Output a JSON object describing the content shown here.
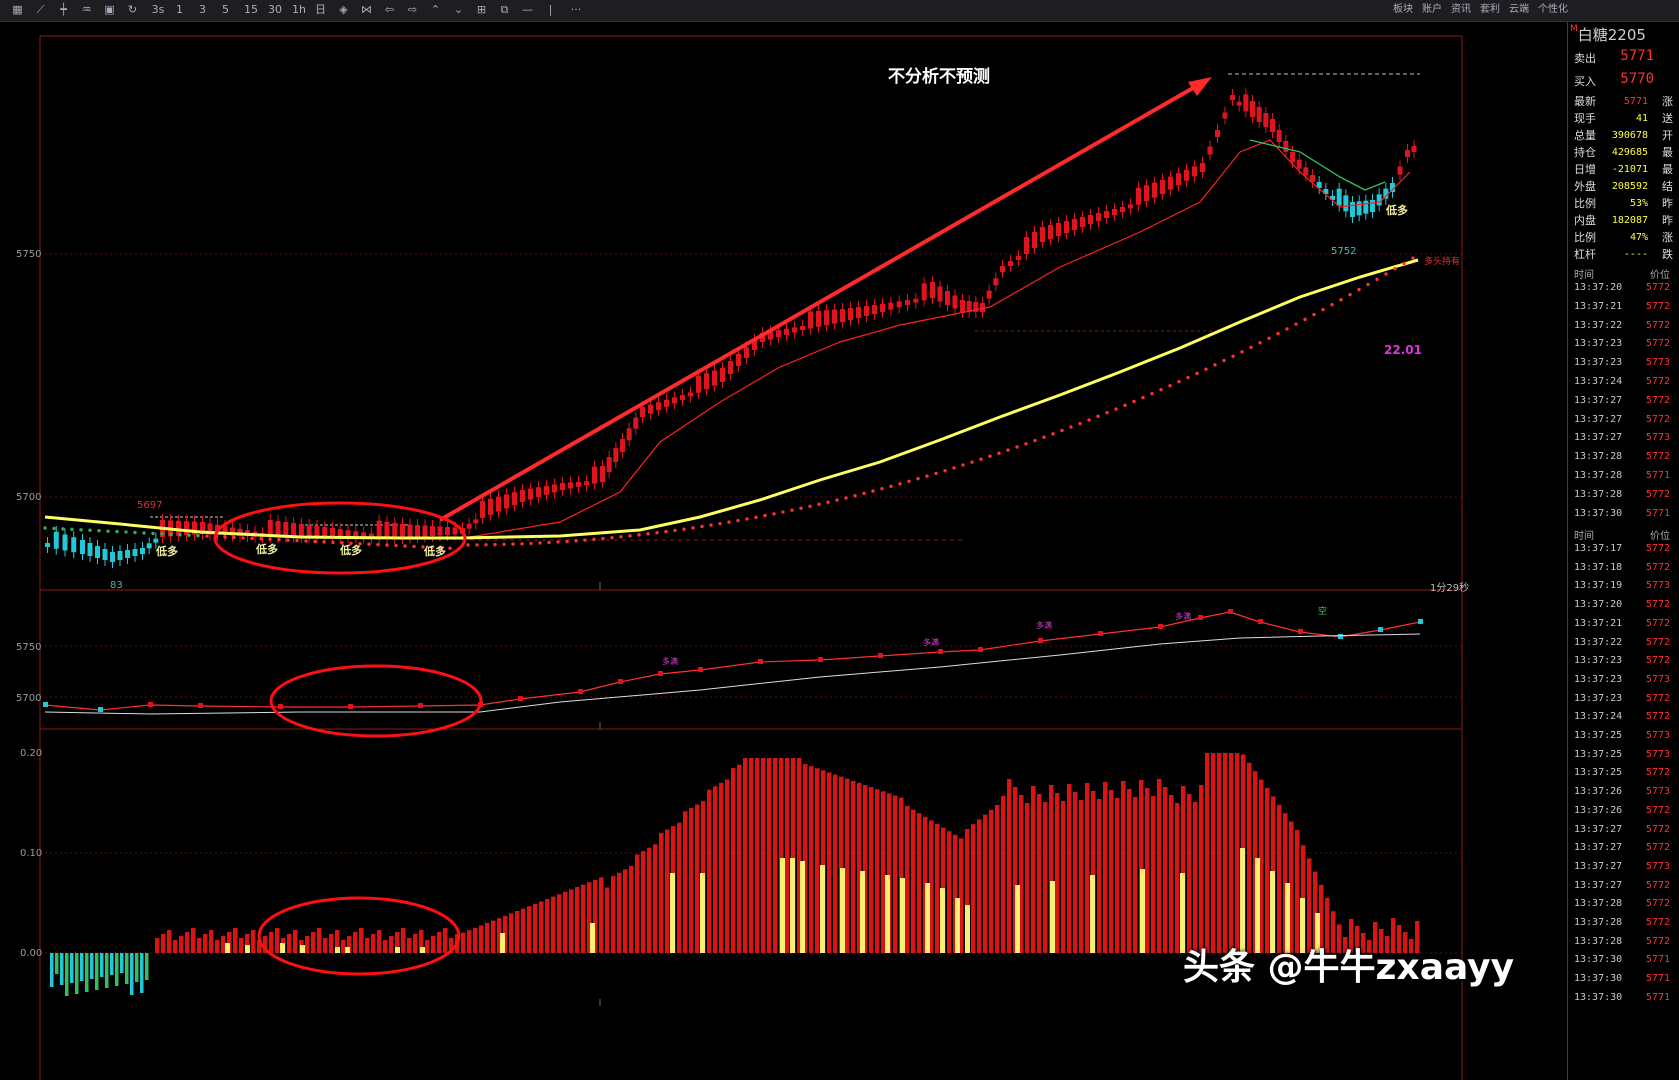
{
  "toolbar": {
    "left_icons": [
      "grid-icon",
      "line-chart-icon",
      "candle-icon",
      "indicator-icon",
      "save-icon",
      "refresh-icon",
      "3s",
      "1",
      "3",
      "5",
      "15",
      "30",
      "1h",
      "日",
      "diamond-icon",
      "bowtie-icon",
      "left-icon",
      "right-icon",
      "up-icon",
      "down-icon",
      "layout-icon",
      "window-icon",
      "—",
      "|",
      "···"
    ],
    "right_tabs": [
      "板块",
      "账户",
      "资讯",
      "套利",
      "云端",
      "个性化"
    ]
  },
  "main_chart": {
    "annotation": "不分析不预测",
    "y_labels": [
      {
        "value": "5750"
      },
      {
        "value": "5700"
      }
    ],
    "price_labels": {
      "high_mark": "5697",
      "low_mark": "83",
      "recent_low": "5752",
      "value_22": "22.01",
      "time_left": "1分29秒",
      "right_tag": "多头持有"
    },
    "signals": [
      "低多",
      "低多",
      "低多",
      "低多",
      "低多"
    ]
  },
  "sub_chart": {
    "y_labels": [
      {
        "value": "5750"
      },
      {
        "value": "5700"
      }
    ],
    "tags": [
      "多满",
      "多满",
      "多满",
      "多满",
      "空"
    ]
  },
  "volume_chart": {
    "y_labels": [
      {
        "value": "0.20"
      },
      {
        "value": "0.10"
      },
      {
        "value": "0.00"
      }
    ]
  },
  "watermark": "头条 @牛牛zxaayy",
  "quote_panel": {
    "title": "白糖2205",
    "title_prefix": "M",
    "sell_label": "卖出",
    "sell_value": "5771",
    "buy_label": "买入",
    "buy_value": "5770",
    "stats": [
      {
        "label": "最新",
        "value": "5771",
        "color": "#ff3030",
        "tail": "涨"
      },
      {
        "label": "现手",
        "value": "41",
        "color": "#ffff40",
        "tail": "送"
      },
      {
        "label": "总量",
        "value": "390678",
        "color": "#ffff40",
        "tail": "开"
      },
      {
        "label": "持仓",
        "value": "429685",
        "color": "#ffff40",
        "tail": "最"
      },
      {
        "label": "日增",
        "value": "-21071",
        "color": "#ffff40",
        "tail": "最"
      },
      {
        "label": "外盘",
        "value": "208592",
        "color": "#ffff40",
        "tail": "结"
      },
      {
        "label": "比例",
        "value": "53%",
        "color": "#ffff40",
        "tail": "昨"
      },
      {
        "label": "内盘",
        "value": "182087",
        "color": "#ffff40",
        "tail": "昨"
      },
      {
        "label": "比例",
        "value": "47%",
        "color": "#ffff40",
        "tail": "涨"
      },
      {
        "label": "杠杆",
        "value": "----",
        "color": "#ffff40",
        "tail": "跌"
      }
    ],
    "tick_header": {
      "time": "时间",
      "price": "价位"
    },
    "ticks_a": [
      {
        "time": "13:37:20",
        "price": "5772"
      },
      {
        "time": "13:37:21",
        "price": "5772"
      },
      {
        "time": "13:37:22",
        "price": "5772"
      },
      {
        "time": "13:37:23",
        "price": "5772"
      },
      {
        "time": "13:37:23",
        "price": "5773"
      },
      {
        "time": "13:37:24",
        "price": "5772"
      },
      {
        "time": "13:37:27",
        "price": "5772"
      },
      {
        "time": "13:37:27",
        "price": "5772"
      },
      {
        "time": "13:37:27",
        "price": "5773"
      },
      {
        "time": "13:37:28",
        "price": "5772"
      },
      {
        "time": "13:37:28",
        "price": "5771"
      },
      {
        "time": "13:37:28",
        "price": "5772"
      },
      {
        "time": "13:37:30",
        "price": "5771"
      }
    ],
    "ticks_b": [
      {
        "time": "13:37:17",
        "price": "5772"
      },
      {
        "time": "13:37:18",
        "price": "5772"
      },
      {
        "time": "13:37:19",
        "price": "5773"
      },
      {
        "time": "13:37:20",
        "price": "5772"
      },
      {
        "time": "13:37:21",
        "price": "5772"
      },
      {
        "time": "13:37:22",
        "price": "5772"
      },
      {
        "time": "13:37:23",
        "price": "5772"
      },
      {
        "time": "13:37:23",
        "price": "5773"
      },
      {
        "time": "13:37:23",
        "price": "5772"
      },
      {
        "time": "13:37:24",
        "price": "5772"
      },
      {
        "time": "13:37:25",
        "price": "5773"
      },
      {
        "time": "13:37:25",
        "price": "5773"
      },
      {
        "time": "13:37:25",
        "price": "5772"
      },
      {
        "time": "13:37:26",
        "price": "5773"
      },
      {
        "time": "13:37:26",
        "price": "5772"
      },
      {
        "time": "13:37:27",
        "price": "5772"
      },
      {
        "time": "13:37:27",
        "price": "5772"
      },
      {
        "time": "13:37:27",
        "price": "5773"
      },
      {
        "time": "13:37:27",
        "price": "5772"
      },
      {
        "time": "13:37:28",
        "price": "5772"
      },
      {
        "time": "13:37:28",
        "price": "5772"
      },
      {
        "time": "13:37:28",
        "price": "5772"
      },
      {
        "time": "13:37:30",
        "price": "5771"
      },
      {
        "time": "13:37:30",
        "price": "5771"
      },
      {
        "time": "13:37:30",
        "price": "5771"
      }
    ]
  },
  "colors": {
    "up": "#e0141e",
    "down": "#20c8d8",
    "ma_yellow": "#ffff60",
    "ma_red": "#ff2020",
    "ma_green": "#30c060",
    "grid": "#5a1010",
    "ellipse": "#ff1010"
  }
}
